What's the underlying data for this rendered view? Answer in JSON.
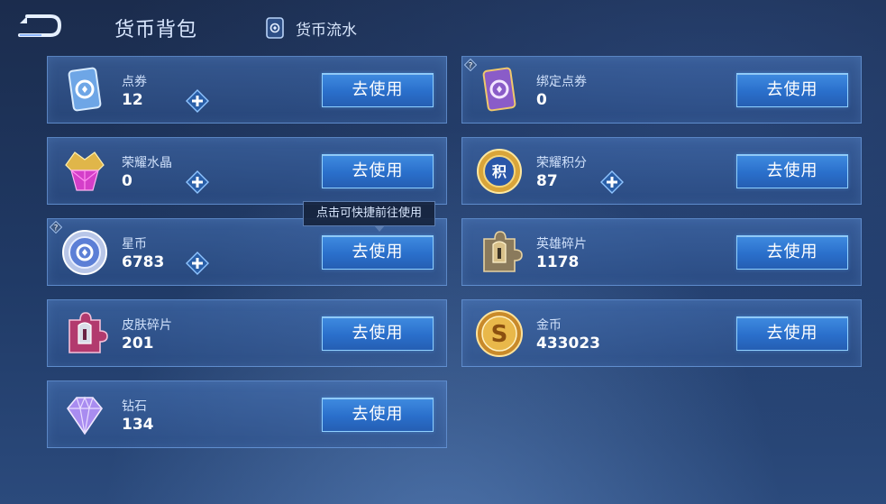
{
  "header": {
    "title": "货币背包",
    "flow_label": "货币流水"
  },
  "tooltip": "点击可快捷前往使用",
  "colors": {
    "accent_button": "#2a6fcb",
    "card_border": "#73a5e6",
    "background": "#203a66"
  },
  "currencies": [
    {
      "name": "点券",
      "amount": "12",
      "icon": "voucher-card-icon",
      "has_plus": true,
      "button": "去使用"
    },
    {
      "name": "绑定点券",
      "amount": "0",
      "icon": "bound-voucher-card-icon",
      "has_plus": false,
      "button": "去使用"
    },
    {
      "name": "荣耀水晶",
      "amount": "0",
      "icon": "glory-crystal-icon",
      "has_plus": true,
      "button": "去使用"
    },
    {
      "name": "荣耀积分",
      "amount": "87",
      "icon": "glory-points-icon",
      "has_plus": true,
      "button": "去使用"
    },
    {
      "name": "星币",
      "amount": "6783",
      "icon": "star-coin-icon",
      "has_plus": true,
      "button": "去使用"
    },
    {
      "name": "英雄碎片",
      "amount": "1178",
      "icon": "hero-fragment-icon",
      "has_plus": false,
      "button": "去使用"
    },
    {
      "name": "皮肤碎片",
      "amount": "201",
      "icon": "skin-fragment-icon",
      "has_plus": false,
      "button": "去使用"
    },
    {
      "name": "金币",
      "amount": "433023",
      "icon": "gold-coin-icon",
      "has_plus": false,
      "button": "去使用"
    },
    {
      "name": "钻石",
      "amount": "134",
      "icon": "diamond-icon",
      "has_plus": false,
      "button": "去使用"
    }
  ]
}
